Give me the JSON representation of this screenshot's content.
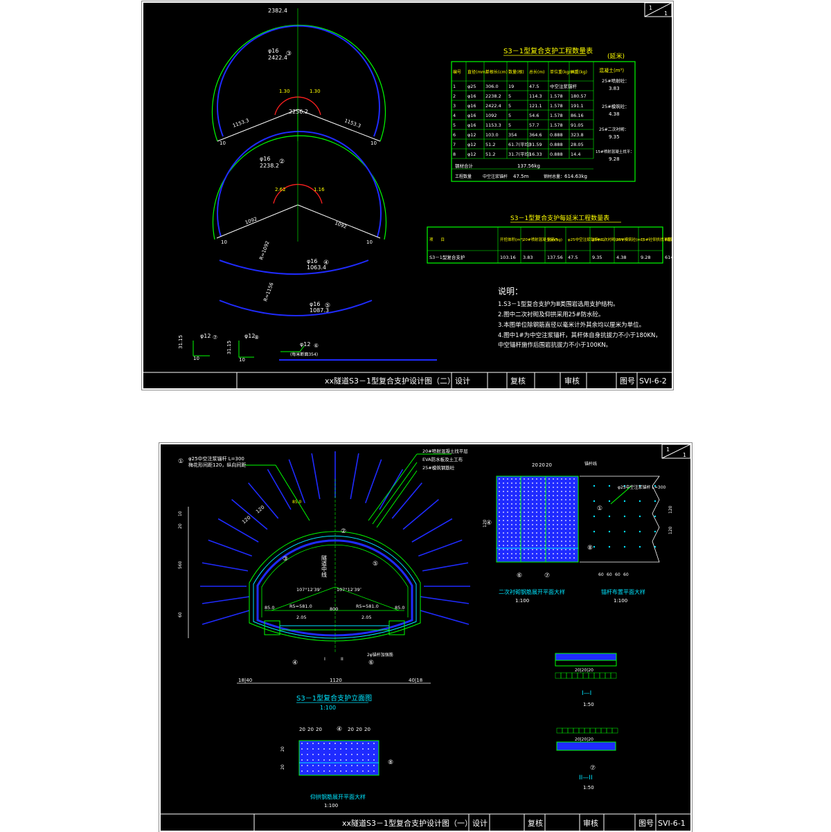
{
  "colors": {
    "background": "#000000",
    "frame": "#ffffff",
    "green": "#00ff00",
    "blue": "#1f2bff",
    "red": "#ff2020",
    "cyan": "#00e5ff",
    "yellow": "#ffff00"
  },
  "sheet1": {
    "corner": [
      "1",
      "1"
    ],
    "title_block": {
      "title": "xx隧道S3－1型复合支护设计图（二）",
      "design": "设计",
      "review": "复核",
      "approve": "审核",
      "drawing_no_label": "图号",
      "drawing_no": "SVI-6-2"
    },
    "arch_labels": {
      "top_arc": "2382.4",
      "bar3": "φ16",
      "bar3_len": "2422.4",
      "bar3_circle": "③",
      "left_a": "1153.3",
      "right_a": "1153.3",
      "mid_a": "1.30",
      "mid_b": "1.30",
      "arc2_top": "2256.2",
      "bar2": "φ16",
      "bar2_len": "2238.2",
      "bar2_circle": "②",
      "left_b": "1092",
      "right_b": "1092",
      "r_a": "2.62",
      "r_b": "1.16",
      "s10": "10",
      "r4": "R=1092",
      "bar4": "φ16",
      "bar4_len": "1063.4",
      "bar4_circle": "④",
      "r5": "R=1156",
      "bar5": "φ16",
      "bar5_len": "1087.3",
      "bar5_circle": "⑤",
      "b7": "φ12",
      "b7c": "⑦",
      "b8": "φ12",
      "b8c": "⑧",
      "b6": "φ12",
      "b6c": "⑥",
      "d31_15": "31.15",
      "d10": "10",
      "d51_2": "51.2",
      "b6_note": "(每米断面354)"
    },
    "qty_table": {
      "title": "S3－1型复合支护工程数量表",
      "unit": "(延米)",
      "headers": [
        "编号",
        "直径(mm)",
        "单根长(cm)",
        "数量(根)",
        "总长(m)",
        "单位重(kg/m)",
        "共重(kg)",
        "混凝土(m³)"
      ],
      "rows": [
        [
          "1",
          "φ25",
          "306.0",
          "19",
          "47.5",
          "中空注浆锚杆",
          ""
        ],
        [
          "2",
          "φ16",
          "2238.2",
          "5",
          "114.3",
          "1.578",
          "180.57"
        ],
        [
          "3",
          "φ16",
          "2422.4",
          "5",
          "121.1",
          "1.578",
          "191.1"
        ],
        [
          "4",
          "φ16",
          "1092",
          "5",
          "54.6",
          "1.578",
          "86.16"
        ],
        [
          "5",
          "φ16",
          "1153.3",
          "5",
          "57.7",
          "1.578",
          "91.05"
        ],
        [
          "6",
          "φ12",
          "103.0",
          "354",
          "364.6",
          "0.888",
          "323.8"
        ],
        [
          "7",
          "φ12",
          "51.2",
          "61.7(平均)",
          "31.59",
          "0.888",
          "28.05"
        ],
        [
          "8",
          "φ12",
          "51.2",
          "31.7(平均)",
          "16.33",
          "0.888",
          "14.4"
        ]
      ],
      "concrete": [
        "25#喷射砼：",
        "3.83",
        "25#模筑砼：",
        "4.38",
        "25#二次衬砌：",
        "9.35",
        "15#喷射混凝土找平：",
        "9.28"
      ],
      "steel_row": {
        "label": "钢材合计",
        "value": "137.56kg"
      },
      "anchor_row": {
        "label": "工程数量",
        "len_label": "中空注浆锚杆",
        "len": "47.5m",
        "wt_label": "钢材总量：",
        "wt": "614.63kg"
      }
    },
    "summary_table": {
      "title": "S3－1型复合支护每延米工程数量表",
      "headers": [
        "项　　目",
        "开挖体积(m³)",
        "20#喷射混凝土(m³)",
        "钢筋(kg)",
        "φ25中空注浆锚杆(m)",
        "25#二次衬砌(m³)",
        "25#模筑砼(m³)",
        "15#砼仰拱找平层(m³)",
        "Ⅱ级钢筋(kg)"
      ],
      "row": [
        "S3－1型复合支护",
        "103.16",
        "3.83",
        "137.56",
        "47.5",
        "9.35",
        "4.38",
        "9.28",
        "614.63"
      ]
    },
    "notes": {
      "heading": "说明：",
      "lines": [
        "1.S3－1型复合支护为Ⅲ类围岩选用支护结构。",
        "2.图中二次衬砌及仰拱采用25#防水砼。",
        "3.本图单位除钢筋直径以毫米计外其余均以厘米为单位。",
        "4.图中1#为中空注浆锚杆，其杆体自身抗拔力不小于180KN，",
        "  中空锚杆施作后围岩抗拔力不小于100KN。"
      ]
    }
  },
  "sheet2": {
    "corner": [
      "1",
      "1"
    ],
    "title_block": {
      "title": "xx隧道S3－1型复合支护设计图（一）",
      "design": "设计",
      "review": "复核",
      "approve": "审核",
      "drawing_no_label": "图号",
      "drawing_no": "SVI-6-1"
    },
    "section": {
      "callout_left_1": "φ25中空注浆锚杆 L=300",
      "callout_left_2": "梅花形间距120，纵向间距",
      "callout_right_1": "20#喷射混凝土找平层",
      "callout_right_2": "EVA防水板及土工布",
      "callout_right_3": "25#模筑钢筋砼",
      "dim_top": "120",
      "dim_top2": "120",
      "r_left": "R5=581.0",
      "r_right": "R5=581.0",
      "ang_left": "107°12′39″",
      "ang_right": "107°12′39″",
      "span_left": "2.05",
      "span_right": "2.05",
      "w85_l": "85.0",
      "w85_r": "85.0",
      "center": "800",
      "axis": "隧道中线",
      "bottom_dim": "1120",
      "dim_l": "18|40",
      "dim_r": "40|18",
      "left_dims": [
        "10",
        "20",
        "560",
        "60"
      ],
      "mark_I": "I",
      "mark_II": "II",
      "anchor_note": "2φ锚杆加强筋",
      "caption": "S3－1型复合支护立面图",
      "scale": "1:100",
      "c1": "①",
      "c2": "②",
      "c3": "③",
      "c4": "④",
      "c5": "⑤",
      "c6": "⑥",
      "c7": "⑦",
      "c8": "⑧"
    },
    "detail_a": {
      "caption": "二次衬砌钢筋展开平面大样",
      "scale": "1:100",
      "dims_top": [
        "20",
        "20",
        "20"
      ],
      "dims_left": [
        "20",
        "20",
        "120"
      ],
      "c6": "⑥",
      "c7": "⑦",
      "c4": "④",
      "c8": "⑧"
    },
    "detail_b": {
      "caption": "锚杆布置平面大样",
      "scale": "1:100",
      "label_top": "锚杆线",
      "anchor": "φ25中空注浆锚杆 L=300",
      "dims_right": [
        "50",
        "120",
        "120",
        "120"
      ],
      "dims_bottom": [
        "60",
        "60",
        "60",
        "60"
      ],
      "c1": "①"
    },
    "detail_c": {
      "caption": "仰拱钢筋展开平面大样",
      "scale": "1:100",
      "dims_top_l": [
        "20",
        "20",
        "20"
      ],
      "dims_top_r": [
        "20",
        "20",
        "20"
      ],
      "dims_left": [
        "20",
        "20",
        "20"
      ],
      "c4": "④",
      "c8": "⑧"
    },
    "section_I": {
      "caption": "I—I",
      "scale": "1:50",
      "dims": [
        "40",
        "15"
      ],
      "mid": "20|20|20"
    },
    "section_II": {
      "caption": "II—II",
      "scale": "1:50",
      "dims": [
        "40",
        "15"
      ],
      "mid": "20|20|20",
      "c7": "⑦"
    }
  }
}
